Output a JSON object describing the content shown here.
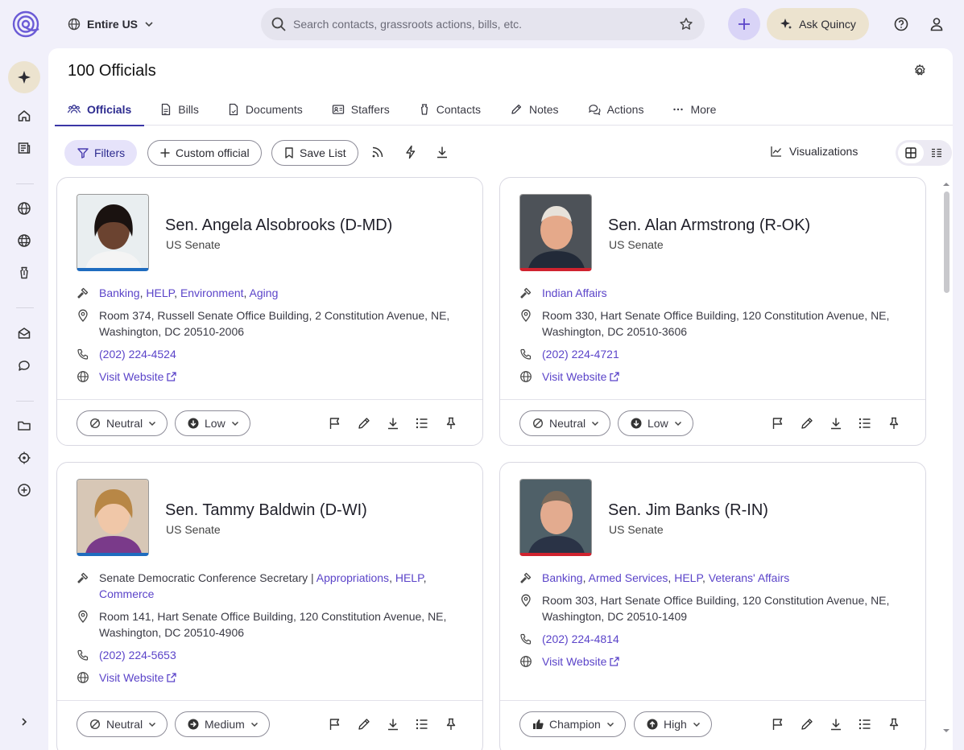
{
  "topbar": {
    "scope_label": "Entire US",
    "search_placeholder": "Search contacts, grassroots actions, bills, etc.",
    "ask_label": "Ask Quincy"
  },
  "page": {
    "title": "100 Officials",
    "tabs": [
      {
        "label": "Officials",
        "icon": "people-icon"
      },
      {
        "label": "Bills",
        "icon": "document-icon"
      },
      {
        "label": "Documents",
        "icon": "file-icon"
      },
      {
        "label": "Staffers",
        "icon": "id-card-icon"
      },
      {
        "label": "Contacts",
        "icon": "person-tie-icon"
      },
      {
        "label": "Notes",
        "icon": "pencil-icon"
      },
      {
        "label": "Actions",
        "icon": "chat-icon"
      },
      {
        "label": "More",
        "icon": "dots-icon"
      }
    ]
  },
  "toolbar": {
    "filters": "Filters",
    "custom_official": "Custom official",
    "save_list": "Save List",
    "visualizations": "Visualizations"
  },
  "cards": [
    {
      "name": "Sen. Angela Alsobrooks (D-MD)",
      "chamber": "US Senate",
      "party": "dem",
      "committee_prefix": "",
      "committees": [
        "Banking",
        "HELP",
        "Environment",
        "Aging"
      ],
      "address_line1": "Room 374, Russell Senate Office Building, 2 Constitution Avenue, NE,",
      "address_line2": "Washington, DC 20510-2006",
      "phone": "(202) 224-4524",
      "website": "Visit Website",
      "sentiment": "Neutral",
      "priority": "Low"
    },
    {
      "name": "Sen. Alan Armstrong (R-OK)",
      "chamber": "US Senate",
      "party": "rep",
      "committee_prefix": "",
      "committees": [
        "Indian Affairs"
      ],
      "address_line1": "Room 330, Hart Senate Office Building, 120 Constitution Avenue, NE,",
      "address_line2": "Washington, DC 20510-3606",
      "phone": "(202) 224-4721",
      "website": "Visit Website",
      "sentiment": "Neutral",
      "priority": "Low"
    },
    {
      "name": "Sen. Tammy Baldwin (D-WI)",
      "chamber": "US Senate",
      "party": "dem",
      "committee_prefix": "Senate Democratic Conference Secretary | ",
      "committees": [
        "Appropriations",
        "HELP",
        "Commerce"
      ],
      "address_line1": "Room 141, Hart Senate Office Building, 120 Constitution Avenue, NE,",
      "address_line2": "Washington, DC 20510-4906",
      "phone": "(202) 224-5653",
      "website": "Visit Website",
      "sentiment": "Neutral",
      "priority": "Medium"
    },
    {
      "name": "Sen. Jim Banks (R-IN)",
      "chamber": "US Senate",
      "party": "rep",
      "committee_prefix": "",
      "committees": [
        "Banking",
        "Armed Services",
        "HELP",
        "Veterans' Affairs"
      ],
      "address_line1": "Room 303, Hart Senate Office Building, 120 Constitution Avenue, NE,",
      "address_line2": "Washington, DC 20510-1409",
      "phone": "(202) 224-4814",
      "website": "Visit Website",
      "sentiment": "Champion",
      "priority": "High"
    }
  ]
}
